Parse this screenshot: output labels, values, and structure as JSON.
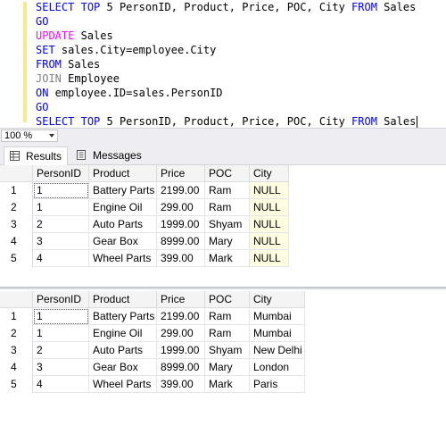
{
  "editor": {
    "lines": [
      {
        "parts": [
          [
            "SELECT",
            "kw"
          ],
          [
            " ",
            " "
          ],
          [
            "TOP",
            "kw"
          ],
          [
            " 5 PersonID, Product, Price, POC, City ",
            ""
          ],
          [
            "FROM",
            "kw"
          ],
          [
            " Sales",
            ""
          ]
        ]
      },
      {
        "parts": [
          [
            "GO",
            "kw"
          ]
        ]
      },
      {
        "parts": [
          [
            "UPDATE",
            "kwm"
          ],
          [
            " Sales",
            ""
          ]
        ]
      },
      {
        "parts": [
          [
            "SET",
            "kw"
          ],
          [
            " sales.City=employee.City",
            ""
          ]
        ]
      },
      {
        "parts": [
          [
            "FROM",
            "kw"
          ],
          [
            " Sales",
            ""
          ]
        ]
      },
      {
        "parts": [
          [
            "JOIN",
            "kwg"
          ],
          [
            " Employee",
            ""
          ]
        ]
      },
      {
        "parts": [
          [
            "ON",
            "kw"
          ],
          [
            " employee.ID=sales.PersonID",
            ""
          ]
        ]
      },
      {
        "parts": [
          [
            "GO",
            "kw"
          ]
        ]
      },
      {
        "parts": [
          [
            "SELECT",
            "kw"
          ],
          [
            " ",
            " "
          ],
          [
            "TOP",
            "kw"
          ],
          [
            " 5 PersonID, Product, Price, POC, City ",
            ""
          ],
          [
            "FROM",
            "kw"
          ],
          [
            " Sales",
            ""
          ]
        ]
      }
    ]
  },
  "zoom": {
    "value": "100 %"
  },
  "tabs": {
    "results": "Results",
    "messages": "Messages"
  },
  "grid1": {
    "headers": [
      "PersonID",
      "Product",
      "Price",
      "POC",
      "City"
    ],
    "rows": [
      [
        "1",
        "1",
        "Battery Parts",
        "2199.00",
        "Ram",
        "NULL"
      ],
      [
        "2",
        "1",
        "Engine Oil",
        "299.00",
        "Ram",
        "NULL"
      ],
      [
        "3",
        "2",
        "Auto Parts",
        "1999.00",
        "Shyam",
        "NULL"
      ],
      [
        "4",
        "3",
        "Gear Box",
        "8999.00",
        "Mary",
        "NULL"
      ],
      [
        "5",
        "4",
        "Wheel Parts",
        "399.00",
        "Mark",
        "NULL"
      ]
    ]
  },
  "grid2": {
    "headers": [
      "PersonID",
      "Product",
      "Price",
      "POC",
      "City"
    ],
    "rows": [
      [
        "1",
        "1",
        "Battery Parts",
        "2199.00",
        "Ram",
        "Mumbai"
      ],
      [
        "2",
        "1",
        "Engine Oil",
        "299.00",
        "Ram",
        "Mumbai"
      ],
      [
        "3",
        "2",
        "Auto Parts",
        "1999.00",
        "Shyam",
        "New Delhi"
      ],
      [
        "4",
        "3",
        "Gear Box",
        "8999.00",
        "Mary",
        "London"
      ],
      [
        "5",
        "4",
        "Wheel Parts",
        "399.00",
        "Mark",
        "Paris"
      ]
    ]
  },
  "colors": {
    "keyword": "#0000ff",
    "update_keyword": "#ff00ff",
    "join_keyword": "#808080",
    "null_cell": "#fffde1"
  }
}
